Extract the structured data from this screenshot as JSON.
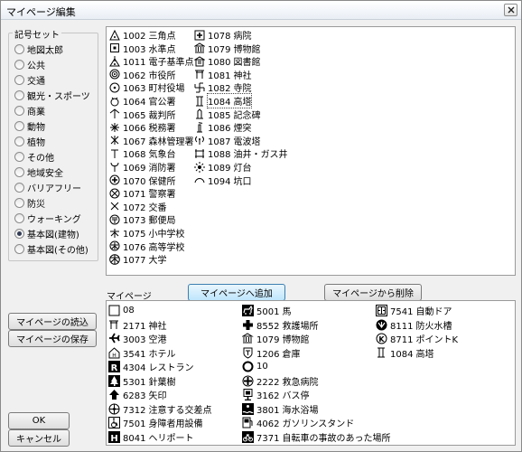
{
  "window": {
    "title": "マイページ編集"
  },
  "symbol_set": {
    "label": "記号セット",
    "options": [
      "地図太郎",
      "公共",
      "交通",
      "観光・スポーツ",
      "商業",
      "動物",
      "植物",
      "その他",
      "地域安全",
      "バリアフリー",
      "防災",
      "ウォーキング",
      "基本図(建物)",
      "基本図(その他)"
    ],
    "selected": "基本図(建物)"
  },
  "symbols": {
    "col1": [
      {
        "code": "1002",
        "name": "三角点",
        "icon": "triangle-dot-icon"
      },
      {
        "code": "1003",
        "name": "水準点",
        "icon": "square-dot-icon"
      },
      {
        "code": "1011",
        "name": "電子基準点",
        "icon": "antenna-triangle-icon"
      },
      {
        "code": "1062",
        "name": "市役所",
        "icon": "double-circle-icon"
      },
      {
        "code": "1063",
        "name": "町村役場",
        "icon": "circle-dot-icon"
      },
      {
        "code": "1064",
        "name": "官公署",
        "icon": "government-office-icon"
      },
      {
        "code": "1065",
        "name": "裁判所",
        "icon": "court-icon"
      },
      {
        "code": "1066",
        "name": "税務署",
        "icon": "tax-office-icon"
      },
      {
        "code": "1067",
        "name": "森林管理署",
        "icon": "forest-office-icon"
      },
      {
        "code": "1068",
        "name": "気象台",
        "icon": "weather-station-icon"
      },
      {
        "code": "1069",
        "name": "消防署",
        "icon": "fire-station-icon"
      },
      {
        "code": "1070",
        "name": "保健所",
        "icon": "health-center-icon"
      },
      {
        "code": "1071",
        "name": "警察署",
        "icon": "police-station-icon"
      },
      {
        "code": "1072",
        "name": "交番",
        "icon": "police-box-icon"
      },
      {
        "code": "1073",
        "name": "郵便局",
        "icon": "post-office-icon"
      },
      {
        "code": "1075",
        "name": "小中学校",
        "icon": "school-icon"
      },
      {
        "code": "1076",
        "name": "高等学校",
        "icon": "high-school-icon"
      },
      {
        "code": "1077",
        "name": "大学",
        "icon": "university-icon"
      }
    ],
    "col2": [
      {
        "code": "1078",
        "name": "病院",
        "icon": "hospital-icon"
      },
      {
        "code": "1079",
        "name": "博物館",
        "icon": "museum-icon"
      },
      {
        "code": "1080",
        "name": "図書館",
        "icon": "library-icon"
      },
      {
        "code": "1081",
        "name": "神社",
        "icon": "shrine-icon"
      },
      {
        "code": "1082",
        "name": "寺院",
        "icon": "temple-icon"
      },
      {
        "code": "1084",
        "name": "高塔",
        "icon": "tower-icon"
      },
      {
        "code": "1085",
        "name": "記念碑",
        "icon": "monument-icon"
      },
      {
        "code": "1086",
        "name": "煙突",
        "icon": "chimney-icon"
      },
      {
        "code": "1087",
        "name": "電波塔",
        "icon": "radio-tower-icon"
      },
      {
        "code": "1088",
        "name": "油井・ガス井",
        "icon": "oil-well-icon"
      },
      {
        "code": "1089",
        "name": "灯台",
        "icon": "lighthouse-icon"
      },
      {
        "code": "1094",
        "name": "坑口",
        "icon": "mine-entrance-icon"
      }
    ]
  },
  "buttons": {
    "add": "マイページへ追加",
    "remove": "マイページから削除",
    "load": "マイページの読込",
    "save": "マイページの保存",
    "ok": "OK",
    "cancel": "キャンセル"
  },
  "mypage": {
    "label": "マイページ",
    "col1": [
      {
        "code": "08",
        "name": "",
        "icon": "black-square-icon"
      },
      {
        "code": "2171",
        "name": "神社",
        "icon": "shrine-icon"
      },
      {
        "code": "3003",
        "name": "空港",
        "icon": "airplane-icon"
      },
      {
        "code": "3541",
        "name": "ホテル",
        "icon": "hotel-icon"
      },
      {
        "code": "4304",
        "name": "レストラン",
        "icon": "restaurant-icon"
      },
      {
        "code": "5301",
        "name": "針葉樹",
        "icon": "conifer-icon"
      },
      {
        "code": "6283",
        "name": "矢印",
        "icon": "arrow-icon"
      },
      {
        "code": "7312",
        "name": "注意する交差点",
        "icon": "caution-intersection-icon"
      },
      {
        "code": "7501",
        "name": "身障者用設備",
        "icon": "wheelchair-icon"
      },
      {
        "code": "8041",
        "name": "ヘリポート",
        "icon": "heliport-icon"
      }
    ],
    "col2": [
      {
        "code": "5001",
        "name": "馬",
        "icon": "horse-icon"
      },
      {
        "code": "8552",
        "name": "救護場所",
        "icon": "first-aid-icon"
      },
      {
        "code": "1079",
        "name": "博物館",
        "icon": "museum-icon"
      },
      {
        "code": "1206",
        "name": "倉庫",
        "icon": "warehouse-icon"
      },
      {
        "code": "10",
        "name": "",
        "icon": "circle-outline-icon"
      },
      {
        "code": "2222",
        "name": "救急病院",
        "icon": "emergency-hospital-icon"
      },
      {
        "code": "3162",
        "name": "バス停",
        "icon": "bus-stop-icon"
      },
      {
        "code": "3801",
        "name": "海水浴場",
        "icon": "beach-icon"
      },
      {
        "code": "4062",
        "name": "ガソリンスタンド",
        "icon": "gas-station-icon"
      },
      {
        "code": "7371",
        "name": "自転車の事故のあった場所",
        "icon": "bicycle-accident-icon"
      }
    ],
    "col3": [
      {
        "code": "7541",
        "name": "自動ドア",
        "icon": "auto-door-icon"
      },
      {
        "code": "8111",
        "name": "防火水槽",
        "icon": "fire-water-tank-icon"
      },
      {
        "code": "8711",
        "name": "ポイントK",
        "icon": "point-k-icon"
      },
      {
        "code": "1084",
        "name": "高塔",
        "icon": "tower-icon"
      }
    ]
  }
}
